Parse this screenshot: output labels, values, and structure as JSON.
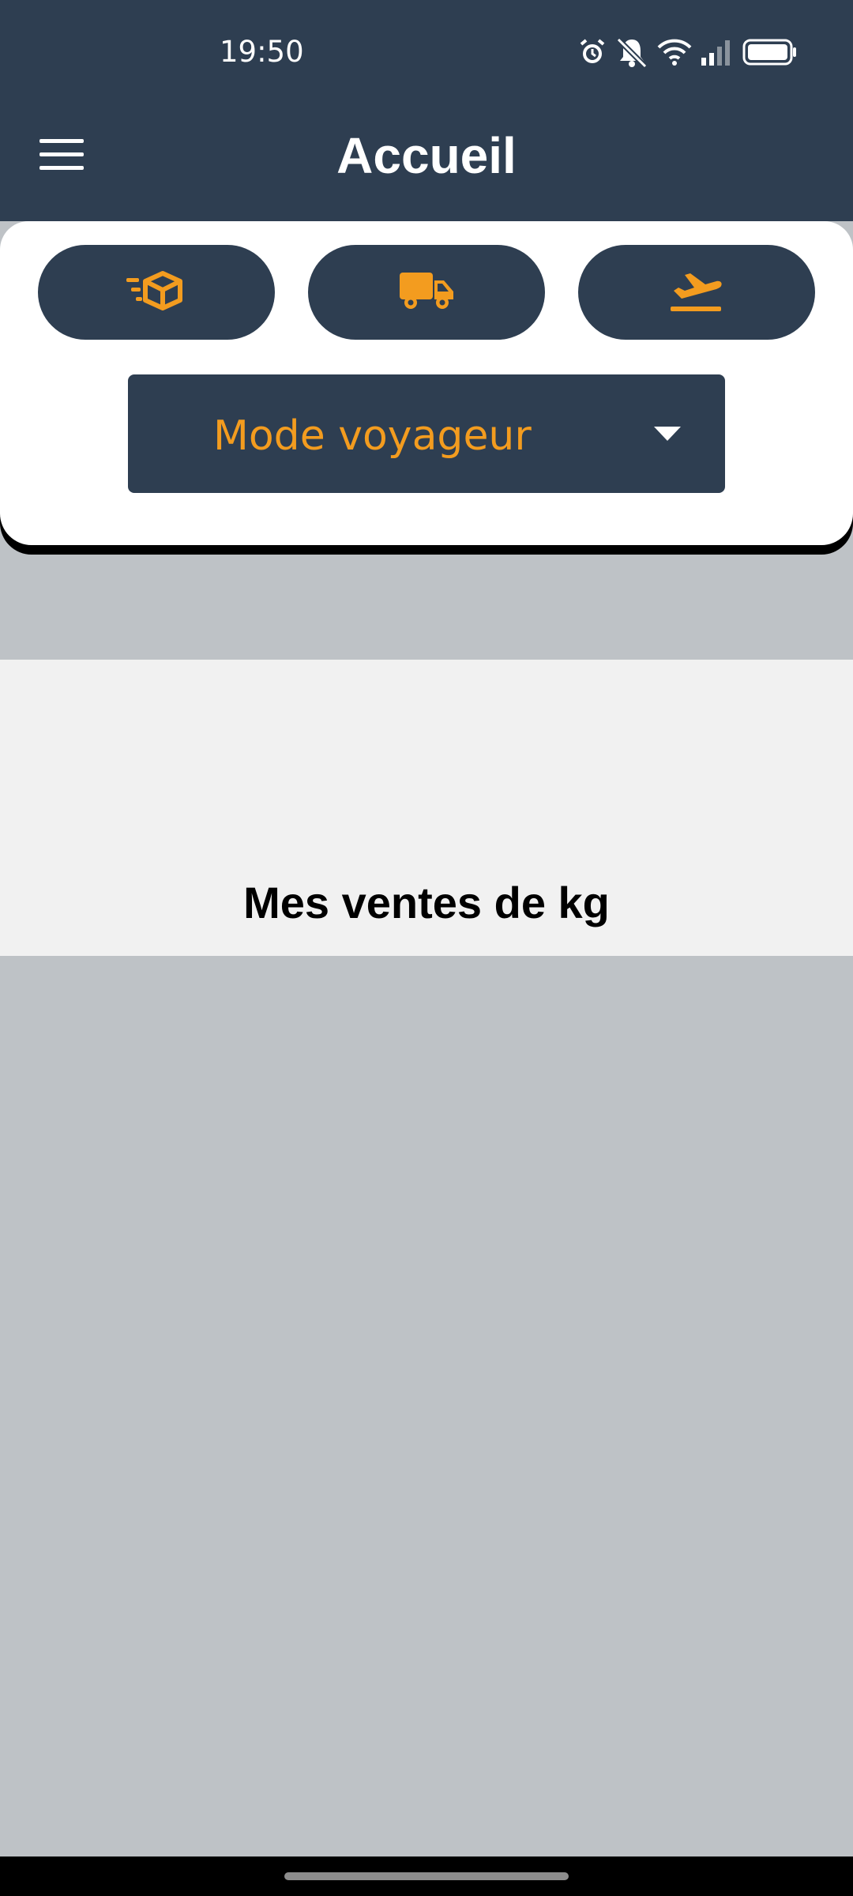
{
  "status_bar": {
    "time": "19:50",
    "icons": [
      "alarm-icon",
      "bell-muted-icon",
      "wifi-icon",
      "signal-icon",
      "battery-icon"
    ]
  },
  "header": {
    "title": "Accueil",
    "menu_icon": "hamburger-menu-icon"
  },
  "actions": [
    {
      "icon": "fast-package-icon"
    },
    {
      "icon": "truck-icon"
    },
    {
      "icon": "plane-departure-icon"
    }
  ],
  "mode_select": {
    "selected": "Mode voyageur",
    "icon": "chevron-down-icon"
  },
  "section": {
    "title": "Mes ventes de kg"
  },
  "colors": {
    "primary": "#2e3e51",
    "accent": "#f39c1f",
    "background": "#bec2c6",
    "band": "#f1f1f1"
  }
}
